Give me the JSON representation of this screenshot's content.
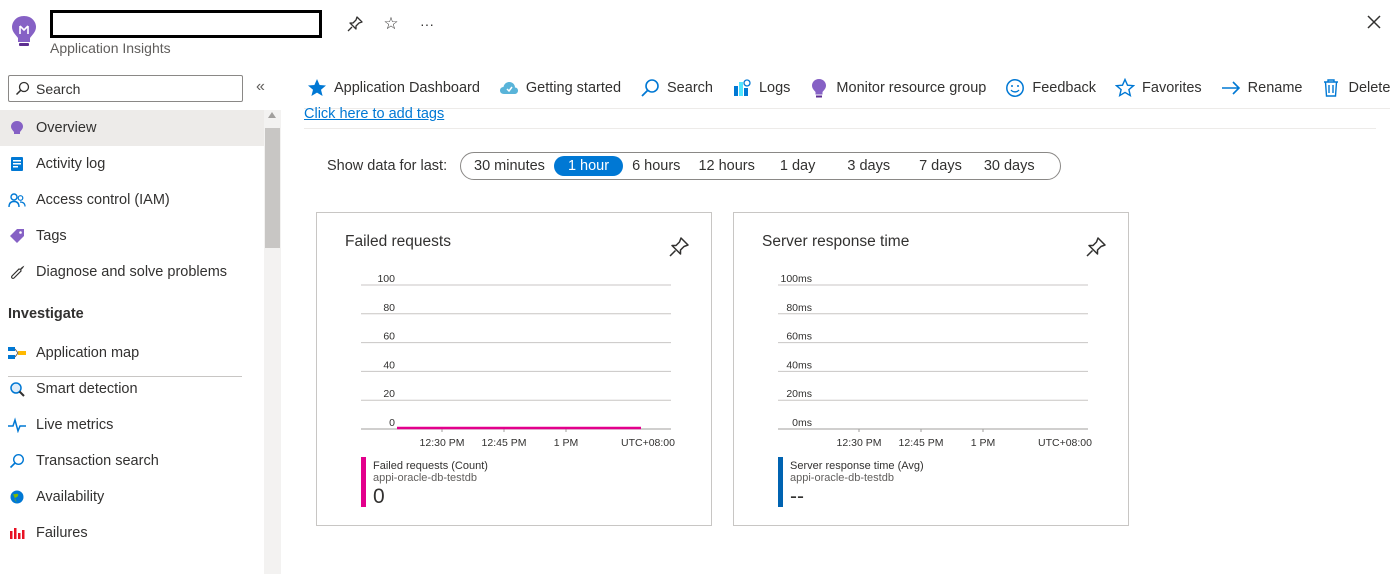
{
  "header": {
    "subtitle": "Application Insights",
    "pin_label": "Pin",
    "favorite_label": "Favorite",
    "more_label": "More",
    "close_label": "Close"
  },
  "sidebar": {
    "search_placeholder": "Search",
    "collapse_glyph": "«",
    "items": [
      {
        "label": "Overview",
        "icon": "lightbulb-icon",
        "active": true
      },
      {
        "label": "Activity log",
        "icon": "activity-log-icon"
      },
      {
        "label": "Access control (IAM)",
        "icon": "people-icon"
      },
      {
        "label": "Tags",
        "icon": "tag-icon"
      },
      {
        "label": "Diagnose and solve problems",
        "icon": "wrench-icon"
      }
    ],
    "section": "Investigate",
    "investigate_items": [
      {
        "label": "Application map",
        "icon": "app-map-icon"
      },
      {
        "label": "Smart detection",
        "icon": "smart-detection-icon"
      },
      {
        "label": "Live metrics",
        "icon": "pulse-icon"
      },
      {
        "label": "Transaction search",
        "icon": "search-icon"
      },
      {
        "label": "Availability",
        "icon": "globe-icon"
      },
      {
        "label": "Failures",
        "icon": "bar-chart-icon"
      }
    ]
  },
  "toolbar": {
    "items": [
      {
        "label": "Application Dashboard",
        "icon": "star-filled-icon"
      },
      {
        "label": "Getting started",
        "icon": "cloud-icon"
      },
      {
        "label": "Search",
        "icon": "search-icon"
      },
      {
        "label": "Logs",
        "icon": "logs-icon"
      },
      {
        "label": "Monitor resource group",
        "icon": "lightbulb-icon"
      },
      {
        "label": "Feedback",
        "icon": "smiley-icon"
      },
      {
        "label": "Favorites",
        "icon": "star-outline-icon"
      },
      {
        "label": "Rename",
        "icon": "arrow-right-icon"
      },
      {
        "label": "Delete",
        "icon": "trash-icon"
      }
    ]
  },
  "main": {
    "tags_link": "Click here to add tags",
    "show_data_label": "Show data for last:",
    "time_ranges": [
      "30 minutes",
      "1 hour",
      "6 hours",
      "12 hours",
      "1 day",
      "3 days",
      "7 days",
      "30 days"
    ],
    "selected_range": "1 hour"
  },
  "colors": {
    "accent": "#0078d4",
    "failed_series": "#e3008c",
    "response_series": "#0063b1"
  },
  "chart_data": [
    {
      "type": "line",
      "title": "Failed requests",
      "y_ticks": [
        "100",
        "80",
        "60",
        "40",
        "20",
        "0"
      ],
      "ylim": [
        0,
        100
      ],
      "x_ticks": [
        "12:30 PM",
        "12:45 PM",
        "1 PM"
      ],
      "x_timezone": "UTC+08:00",
      "series": [
        {
          "name": "Failed requests (Count)",
          "values": [
            0,
            0,
            0,
            0,
            0,
            0,
            0,
            0,
            0,
            0,
            0,
            0,
            0
          ]
        }
      ],
      "legend": {
        "name": "Failed requests (Count)",
        "resource": "appi-oracle-db-testdb",
        "value": "0"
      }
    },
    {
      "type": "line",
      "title": "Server response time",
      "y_ticks": [
        "100ms",
        "80ms",
        "60ms",
        "40ms",
        "20ms",
        "0ms"
      ],
      "ylim": [
        0,
        100
      ],
      "x_ticks": [
        "12:30 PM",
        "12:45 PM",
        "1 PM"
      ],
      "x_timezone": "UTC+08:00",
      "series": [
        {
          "name": "Server response time (Avg)",
          "values": []
        }
      ],
      "legend": {
        "name": "Server response time (Avg)",
        "resource": "appi-oracle-db-testdb",
        "value": "--"
      }
    }
  ]
}
